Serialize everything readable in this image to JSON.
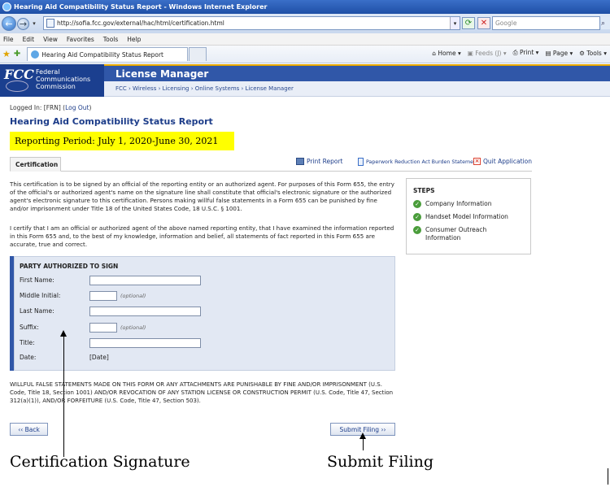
{
  "browser": {
    "window_title": "Hearing Aid Compatibility Status Report - Windows Internet Explorer",
    "url": "http://sofia.fcc.gov/external/hac/html/certification.html",
    "search_placeholder": "Google",
    "menu": [
      "File",
      "Edit",
      "View",
      "Favorites",
      "Tools",
      "Help"
    ],
    "tab_title": "Hearing Aid Compatibility Status Report",
    "commands": {
      "home": "Home",
      "feeds": "Feeds (J)",
      "print": "Print",
      "page": "Page",
      "tools": "Tools"
    }
  },
  "header": {
    "logo_text": "FCC",
    "org_line1": "Federal",
    "org_line2": "Communications",
    "org_line3": "Commission",
    "app_title": "License Manager",
    "breadcrumb": "FCC › Wireless › Licensing › Online Systems › License Manager"
  },
  "session": {
    "logged_in_prefix": "Logged In: [FRN] (",
    "logout_label": "Log Out",
    "logged_in_suffix": ")"
  },
  "page": {
    "title": "Hearing Aid Compatibility Status Report",
    "reporting_period": "Reporting Period:  July 1, 2020-June 30, 2021",
    "tab_label": "Certification",
    "print_label": "Print Report",
    "paperwork_label": "Paperwork Reduction Act Burden Statement",
    "quit_label": "Quit Application"
  },
  "text": {
    "para1": "This certification is to be signed by an official of the reporting entity or an authorized agent. For purposes of this Form 655, the entry of the official's or authorized agent's name on the signature line shall constitute that official's electronic signature or the authorized agent's electronic signature to this certification. Persons making willful false statements in a Form 655 can be punished by fine and/or imprisonment under Title 18 of the United States Code, 18 U.S.C. § 1001.",
    "para2": "I certify that I am an official or authorized agent of the above named reporting entity, that I have examined the information reported in this Form 655 and, to the best of my knowledge, information and belief, all statements of fact reported in this Form 655 are accurate, true and correct.",
    "warning": "WILLFUL FALSE STATEMENTS MADE ON THIS FORM OR ANY ATTACHMENTS ARE PUNISHABLE BY FINE AND/OR IMPRISONMENT (U.S. Code, Title 18, Section 1001) AND/OR REVOCATION OF ANY STATION LICENSE OR CONSTRUCTION PERMIT (U.S. Code, Title 47, Section 312(a)(1)), AND/OR FORFEITURE (U.S. Code, Title 47, Section 503)."
  },
  "steps": {
    "heading": "STEPS",
    "items": [
      "Company Information",
      "Handset Model Information",
      "Consumer Outreach Information"
    ]
  },
  "form": {
    "heading": "PARTY AUTHORIZED TO SIGN",
    "first_name_label": "First Name:",
    "middle_initial_label": "Middle Initial:",
    "last_name_label": "Last Name:",
    "suffix_label": "Suffix:",
    "title_label": "Title:",
    "date_label": "Date:",
    "date_value": "[Date]",
    "optional_text": "(optional)",
    "first_name_value": "",
    "middle_initial_value": "",
    "last_name_value": "",
    "suffix_value": "",
    "title_value": ""
  },
  "buttons": {
    "back_label": "‹‹ Back",
    "submit_label": "Submit Filing ››"
  },
  "annotations": {
    "signature": "Certification Signature",
    "submit": "Submit Filing"
  }
}
